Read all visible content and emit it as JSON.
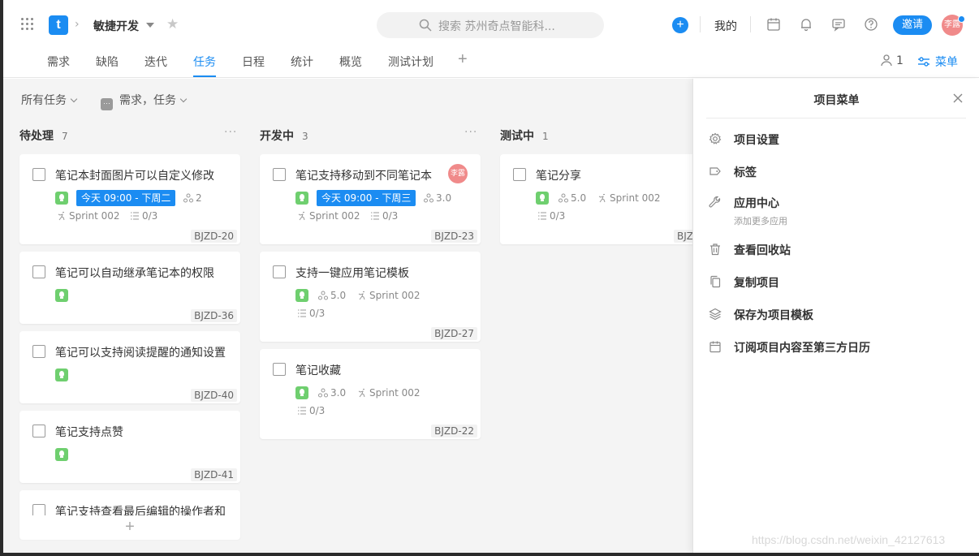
{
  "topbar": {
    "logo_letter": "t",
    "project_name": "敏捷开发",
    "search_placeholder": "搜索 苏州奇点智能科...",
    "add_symbol": "+",
    "mine_label": "我的",
    "invite_label": "邀请",
    "user_avatar_text": "李露",
    "accent_color": "#1b8cf2"
  },
  "nav": {
    "tabs": [
      {
        "label": "需求"
      },
      {
        "label": "缺陷"
      },
      {
        "label": "迭代"
      },
      {
        "label": "任务",
        "active": true
      },
      {
        "label": "日程"
      },
      {
        "label": "统计"
      },
      {
        "label": "概览"
      },
      {
        "label": "测试计划"
      }
    ],
    "add_symbol": "+",
    "member_count": "1",
    "menu_label": "菜单"
  },
  "filters": {
    "scope_label": "所有任务",
    "type_badge": "···",
    "type_label": "需求，任务"
  },
  "columns": [
    {
      "name": "待处理",
      "count": "7",
      "more": "···",
      "cards": [
        {
          "title": "笔记本封面图片可以自定义修改",
          "due": "今天 09:00 - 下周二",
          "points": "2",
          "sprint": "Sprint 002",
          "checklist": "0/3",
          "code": "BJZD-20"
        },
        {
          "title": "笔记可以自动继承笔记本的权限",
          "code": "BJZD-36"
        },
        {
          "title": "笔记可以支持阅读提醒的通知设置",
          "code": "BJZD-40"
        },
        {
          "title": "笔记支持点赞",
          "code": "BJZD-41"
        },
        {
          "title": "笔记支持查看最后编辑的操作者和"
        }
      ],
      "add_symbol": "+"
    },
    {
      "name": "开发中",
      "count": "3",
      "more": "···",
      "cards": [
        {
          "title": "笔记支持移动到不同笔记本",
          "avatar": "李露",
          "due": "今天 09:00 - 下周三",
          "points": "3.0",
          "sprint": "Sprint 002",
          "checklist": "0/3",
          "code": "BJZD-23"
        },
        {
          "title": "支持一键应用笔记模板",
          "points": "5.0",
          "sprint": "Sprint 002",
          "checklist": "0/3",
          "code": "BJZD-27"
        },
        {
          "title": "笔记收藏",
          "points": "3.0",
          "sprint": "Sprint 002",
          "checklist": "0/3",
          "code": "BJZD-22"
        }
      ]
    },
    {
      "name": "测试中",
      "count": "1",
      "cards": [
        {
          "title": "笔记分享",
          "points": "5.0",
          "sprint": "Sprint 002",
          "checklist": "0/3",
          "code": "BJZ"
        }
      ]
    }
  ],
  "panel": {
    "title": "项目菜单",
    "items": [
      {
        "label": "项目设置",
        "icon": "gear-icon"
      },
      {
        "label": "标签",
        "icon": "tag-icon"
      },
      {
        "label": "应用中心",
        "sub": "添加更多应用",
        "icon": "wrench-icon"
      },
      {
        "label": "查看回收站",
        "icon": "trash-icon"
      },
      {
        "label": "复制项目",
        "icon": "copy-icon"
      },
      {
        "label": "保存为项目模板",
        "icon": "layers-icon"
      },
      {
        "label": "订阅项目内容至第三方日历",
        "icon": "calendar-icon"
      }
    ]
  },
  "watermark": "https://blog.csdn.net/weixin_42127613"
}
